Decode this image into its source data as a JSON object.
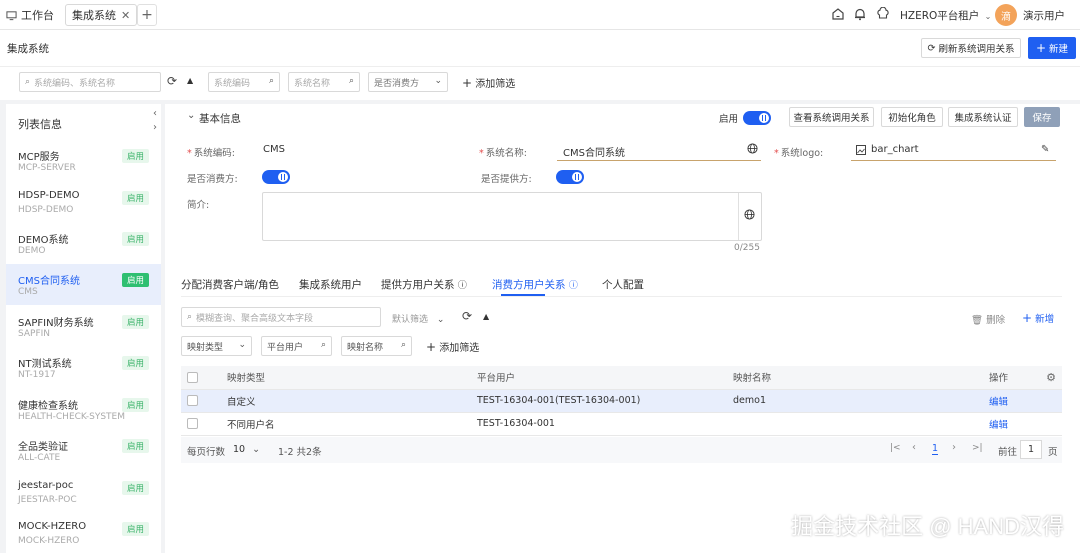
{
  "topbar": {
    "workbench_label": "工作台",
    "active_tab_label": "集成系统",
    "tenant_label": "HZERO平台租户",
    "avatar_text": "滴",
    "user_label": "演示用户"
  },
  "page": {
    "title": "集成系统",
    "refresh_label": "刷新系统调用关系",
    "new_label": "新建"
  },
  "filters": {
    "search_placeholder": "系统编码、系统名称",
    "system_code": "系统编码",
    "system_name": "系统名称",
    "is_consumer": "是否消费方",
    "add_filter": "添加筛选"
  },
  "sidebar": {
    "title": "列表信息",
    "items": [
      {
        "name": "MCP服务",
        "code": "MCP-SERVER",
        "status": "启用"
      },
      {
        "name": "HDSP-DEMO",
        "code": "HDSP-DEMO",
        "status": "启用"
      },
      {
        "name": "DEMO系统",
        "code": "DEMO",
        "status": "启用"
      },
      {
        "name": "CMS合同系统",
        "code": "CMS",
        "status": "启用"
      },
      {
        "name": "SAPFIN财务系统",
        "code": "SAPFIN",
        "status": "启用"
      },
      {
        "name": "NT测试系统",
        "code": "NT-1917",
        "status": "启用"
      },
      {
        "name": "健康检查系统",
        "code": "HEALTH-CHECK-SYSTEM",
        "status": "启用"
      },
      {
        "name": "全品类验证",
        "code": "ALL-CATE",
        "status": "启用"
      },
      {
        "name": "jeestar-poc",
        "code": "JEESTAR-POC",
        "status": "启用"
      },
      {
        "name": "MOCK-HZERO",
        "code": "MOCK-HZERO",
        "status": "启用"
      }
    ]
  },
  "detail": {
    "section_title": "基本信息",
    "enable_label": "启用",
    "view_relations": "查看系统调用关系",
    "init_role": "初始化角色",
    "auth": "集成系统认证",
    "save": "保存",
    "code_label": "系统编码:",
    "code_value": "CMS",
    "name_label": "系统名称:",
    "name_value": "CMS合同系统",
    "logo_label": "系统logo:",
    "logo_value": "bar_chart",
    "consumer_label": "是否消费方:",
    "provider_label": "是否提供方:",
    "intro_label": "简介:",
    "intro_counter": "0/255"
  },
  "subtabs": [
    "分配消费客户端/角色",
    "集成系统用户",
    "提供方用户关系",
    "消费方用户关系",
    "个人配置"
  ],
  "subfilters": {
    "search_placeholder": "模糊查询、聚合高级文本字段",
    "default_filter": "默认筛选",
    "delete": "删除",
    "add": "新增",
    "mapping_type": "映射类型",
    "platform_user": "平台用户",
    "mapping_name": "映射名称",
    "add_filter": "添加筛选"
  },
  "table": {
    "headers": [
      "映射类型",
      "平台用户",
      "映射名称",
      "操作"
    ],
    "rows": [
      {
        "type": "自定义",
        "user": "TEST-16304-001(TEST-16304-001)",
        "name": "demo1",
        "action": "编辑"
      },
      {
        "type": "不同用户名",
        "user": "TEST-16304-001",
        "name": "",
        "action": "编辑"
      }
    ]
  },
  "pager": {
    "rows_label": "每页行数",
    "page_size": "10",
    "range": "1-2  共2条",
    "current": "1",
    "goto_label": "前往",
    "goto_value": "1",
    "page_unit": "页"
  },
  "watermark": "掘金技术社区 @ HAND汉得"
}
